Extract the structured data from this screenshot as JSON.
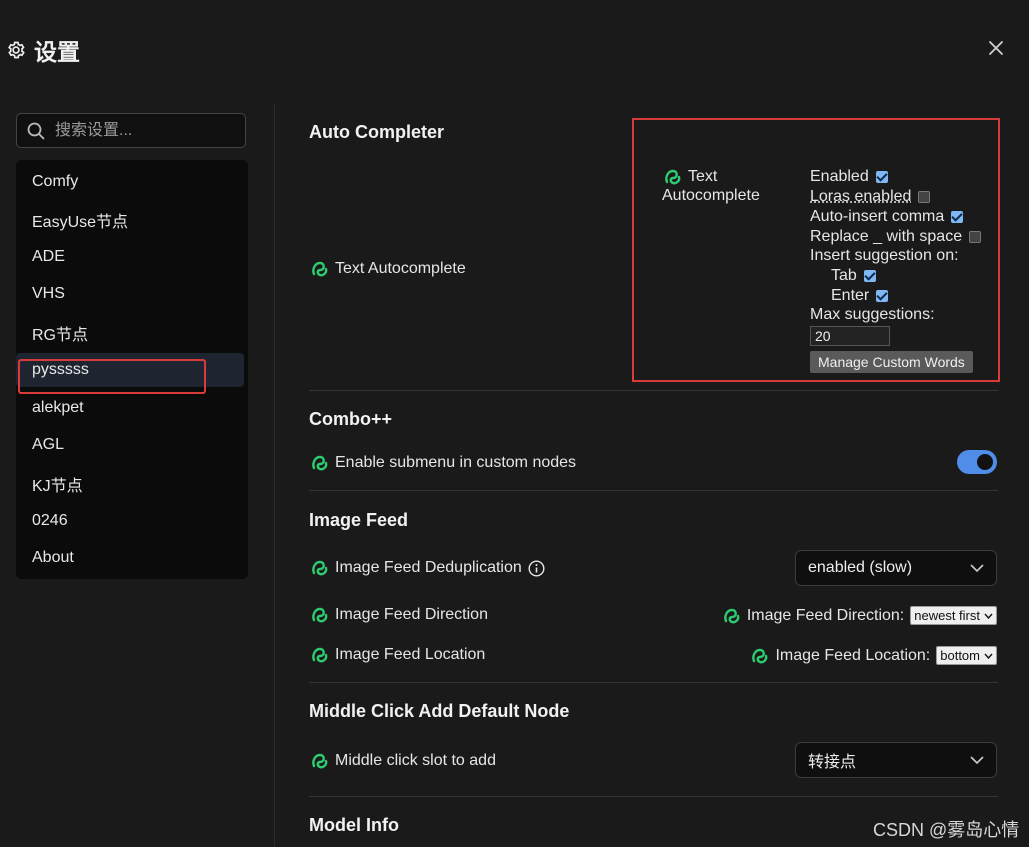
{
  "window": {
    "title": "设置"
  },
  "search": {
    "placeholder": "搜索设置..."
  },
  "sidebar": {
    "items": [
      {
        "label": "Comfy"
      },
      {
        "label": "EasyUse节点"
      },
      {
        "label": "ADE"
      },
      {
        "label": "VHS"
      },
      {
        "label": "RG节点"
      },
      {
        "label": "pysssss"
      },
      {
        "label": "alekpet"
      },
      {
        "label": "AGL"
      },
      {
        "label": "KJ节点"
      },
      {
        "label": "0246"
      },
      {
        "label": "About"
      }
    ],
    "active": "pysssss"
  },
  "sections": {
    "auto_completer": {
      "title": "Auto Completer",
      "setting_label": "Text Autocomplete",
      "panel": {
        "label_line1": "Text",
        "label_line2": "Autocomplete",
        "enabled": "Enabled",
        "loras_enabled": "Loras enabled",
        "auto_insert_comma": "Auto-insert comma",
        "replace_underscore": "Replace _ with space",
        "insert_suggestion_on": "Insert suggestion on:",
        "tab": "Tab",
        "enter": "Enter",
        "max_suggestions": "Max suggestions:",
        "max_suggestions_value": "20",
        "manage_button": "Manage Custom Words"
      }
    },
    "combo": {
      "title": "Combo++",
      "setting_label": "Enable submenu in custom nodes"
    },
    "image_feed": {
      "title": "Image Feed",
      "dedup_label": "Image Feed Deduplication",
      "dedup_value": "enabled (slow)",
      "direction_label": "Image Feed Direction",
      "direction_inline_label": "Image Feed Direction:",
      "direction_value": "newest first",
      "location_label": "Image Feed Location",
      "location_inline_label": "Image Feed Location:",
      "location_value": "bottom"
    },
    "middle_click": {
      "title": "Middle Click Add Default Node",
      "setting_label": "Middle click slot to add",
      "value": "转接点"
    },
    "model_info": {
      "title": "Model Info"
    }
  },
  "watermark": "CSDN @雾岛心情",
  "colors": {
    "accent": "#4f8de8",
    "highlight_border": "#d83b3b",
    "logo_green": "#2ecc71",
    "checkbox_on": "#7fb8f5"
  }
}
